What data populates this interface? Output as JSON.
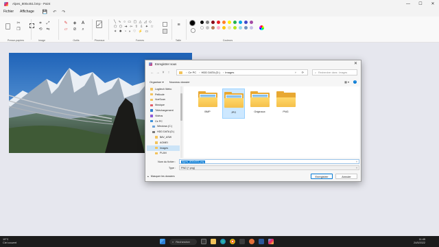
{
  "window": {
    "title": "Alpes_800x451.bmp - Paint",
    "controls": [
      "—",
      "☐",
      "✕"
    ]
  },
  "menu": {
    "items": [
      "Fichier",
      "Affichage"
    ],
    "quick_access": [
      "💾",
      "↶",
      "↷"
    ]
  },
  "ribbon": {
    "groups": [
      "Presse-papiers",
      "Image",
      "Outils",
      "Pinceaux",
      "Formes",
      "Taille",
      "Couleurs"
    ],
    "colors": {
      "primary": "#000000",
      "secondary": "#ffffff",
      "palette_row1": [
        "#000000",
        "#7f7f7f",
        "#880015",
        "#ed1c24",
        "#ff7f27",
        "#fff200",
        "#22b14c",
        "#00a2e8",
        "#3f48cc",
        "#a349a4"
      ],
      "palette_row2": [
        "#ffffff",
        "#c3c3c3",
        "#b97a57",
        "#ffaec9",
        "#ffc90e",
        "#efe4b0",
        "#b5e61d",
        "#99d9ea",
        "#7092be",
        "#c8bfe7"
      ]
    }
  },
  "dialog": {
    "title": "Enregistrer sous",
    "close": "✕",
    "nav": {
      "back": "←",
      "forward": "→",
      "up_list": "˅",
      "up": "↑"
    },
    "address": [
      "Ce PC",
      "HDD DATA (D:)",
      "Images"
    ],
    "refresh": "⟳",
    "search_placeholder": "Rechercher dans : Images",
    "toolbar": {
      "organize": "Organiser ▾",
      "new_folder": "Nouveau dossier",
      "view": "▦ ▾",
      "help": "?"
    },
    "nav_pane": [
      {
        "label": "Logitech Webc",
        "color": "#f2c35b"
      },
      {
        "label": "Pellicule",
        "color": "#f2c35b"
      },
      {
        "label": "VueScan",
        "color": "#f2c35b"
      },
      {
        "label": "Musique",
        "color": "#e35d6a"
      },
      {
        "label": "Téléchargement",
        "color": "#2f7fd1"
      },
      {
        "label": "Vidéos",
        "color": "#8c5ad8"
      },
      {
        "label": "Ce PC",
        "color": "#3b8fd9"
      },
      {
        "label": "Windows (C:)",
        "color": "#6aa0d8"
      },
      {
        "label": "HDD DATA (D:)",
        "color": "#777777"
      },
      {
        "label": "$AV_ASW",
        "color": "#f2c35b"
      },
      {
        "label": "AOMEI",
        "color": "#f2c35b"
      },
      {
        "label": "Images",
        "color": "#f2c35b",
        "selected": true
      },
      {
        "label": "PLAN",
        "color": "#f2c35b"
      }
    ],
    "files": [
      {
        "name": "BMP",
        "photo": true,
        "selected": false
      },
      {
        "name": "JPG",
        "photo": true,
        "selected": true
      },
      {
        "name": "Originaux",
        "photo": true,
        "selected": false
      },
      {
        "name": "PNG",
        "photo": false,
        "selected": false
      }
    ],
    "filename_label": "Nom du fichier :",
    "filename_value": "Alpes_800x451.png",
    "type_label": "Type :",
    "type_value": "PNG (*.png)",
    "hide_folders": "Masquer les dossiers",
    "save_button": "Enregistrer",
    "cancel_button": "Annuler"
  },
  "taskbar": {
    "weather_temp": "19°C",
    "weather_desc": "Ciel couvert",
    "search_label": "Rechercher",
    "time": "11:45",
    "date": "24/5/2022"
  }
}
